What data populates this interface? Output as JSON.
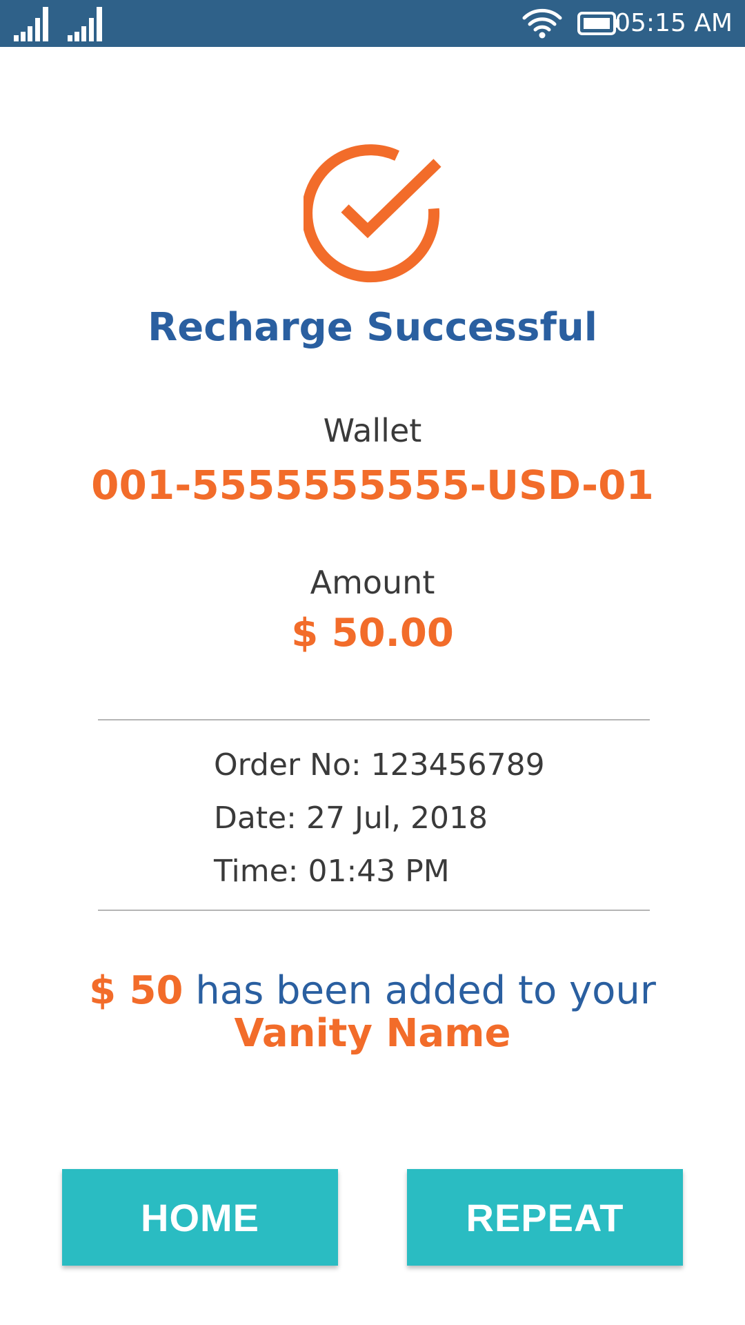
{
  "status_bar": {
    "time": "05:15 AM",
    "icons": [
      "signal-icon",
      "signal-icon",
      "wifi-icon",
      "battery-icon"
    ]
  },
  "result": {
    "icon": "check-circle-icon",
    "title": "Recharge Successful"
  },
  "wallet": {
    "label": "Wallet",
    "value": "001-5555555555-USD-01"
  },
  "amount": {
    "label": "Amount",
    "value": "$ 50.00"
  },
  "details": {
    "order": "Order No: 123456789",
    "date": "Date: 27 Jul, 2018",
    "time": "Time: 01:43 PM"
  },
  "confirmation": {
    "amount": "$ 50",
    "message": " has been added to your",
    "name": "Vanity Name"
  },
  "buttons": {
    "home": "HOME",
    "repeat": "REPEAT"
  },
  "colors": {
    "status_bar": "#2f6189",
    "accent_orange": "#f26c2a",
    "title_blue": "#2a5fa0",
    "button_teal": "#2abcc2"
  }
}
